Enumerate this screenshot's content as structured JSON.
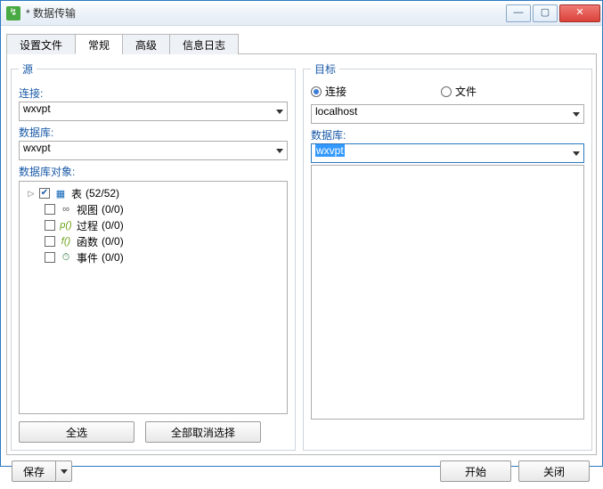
{
  "window": {
    "title": "* 数据传输"
  },
  "win_buttons": {
    "minimize": "—",
    "maximize": "▢",
    "close": "✕"
  },
  "tabs": {
    "settings_file": "设置文件",
    "general": "常规",
    "advanced": "高级",
    "log": "信息日志"
  },
  "source": {
    "legend": "源",
    "connection_label": "连接:",
    "connection_value": "wxvpt",
    "database_label": "数据库:",
    "database_value": "wxvpt",
    "objects_label": "数据库对象:",
    "tree": {
      "tables": {
        "label": "表",
        "count": "(52/52)",
        "checked": true
      },
      "views": {
        "label": "视图",
        "count": "(0/0)",
        "checked": false
      },
      "procs": {
        "label": "过程",
        "count": "(0/0)",
        "checked": false
      },
      "funcs": {
        "label": "函数",
        "count": "(0/0)",
        "checked": false
      },
      "events": {
        "label": "事件",
        "count": "(0/0)",
        "checked": false
      }
    },
    "select_all": "全选",
    "deselect_all": "全部取消选择"
  },
  "target": {
    "legend": "目标",
    "mode_connection": "连接",
    "mode_file": "文件",
    "connection_value": "localhost",
    "database_label": "数据库:",
    "database_value": "wxvpt"
  },
  "bottom": {
    "save": "保存",
    "start": "开始",
    "close": "关闭"
  }
}
